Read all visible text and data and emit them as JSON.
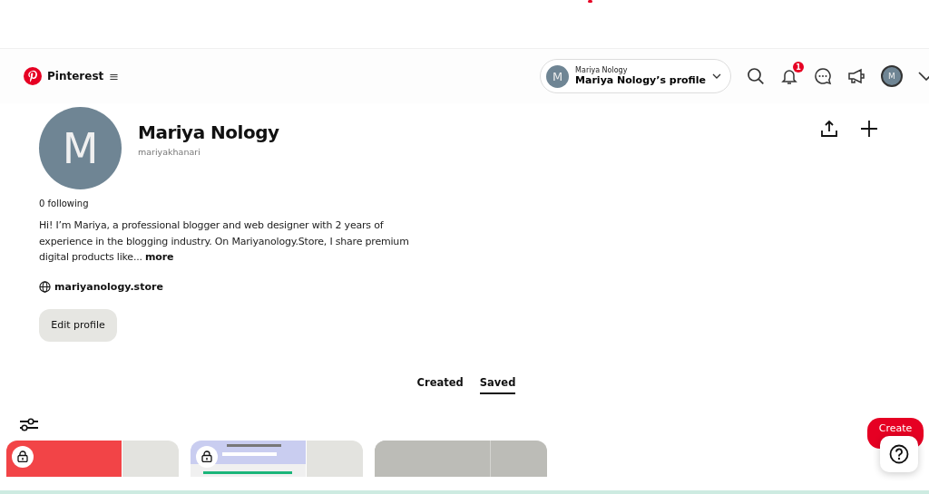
{
  "header": {
    "brand": "Pinterest",
    "menu_glyph": "≡",
    "account": {
      "initial": "M",
      "name": "Mariya Nology",
      "label": "Mariya Nology’s profile"
    },
    "notification_count": "1",
    "avatar_initial": "M"
  },
  "profile": {
    "initial": "M",
    "name": "Mariya Nology",
    "username": "mariyakhanari",
    "following": "0 following",
    "bio": "Hi! I’m Mariya, a professional blogger and web designer with 2 years of experience in the blogging industry. On Mariyanology.Store, I share premium digital products like...",
    "more": "more",
    "website": "mariyanology.store",
    "edit_button": "Edit profile"
  },
  "tabs": [
    {
      "label": "Created",
      "selected": false
    },
    {
      "label": "Saved",
      "selected": true
    }
  ],
  "boards": [
    {
      "kind": "picture",
      "locked": true,
      "color": "#f24447"
    },
    {
      "kind": "picture",
      "locked": true,
      "color": "#c9cdf0"
    },
    {
      "kind": "picture",
      "locked": false,
      "color": "#bcbcb7"
    }
  ],
  "create_button": "Create"
}
